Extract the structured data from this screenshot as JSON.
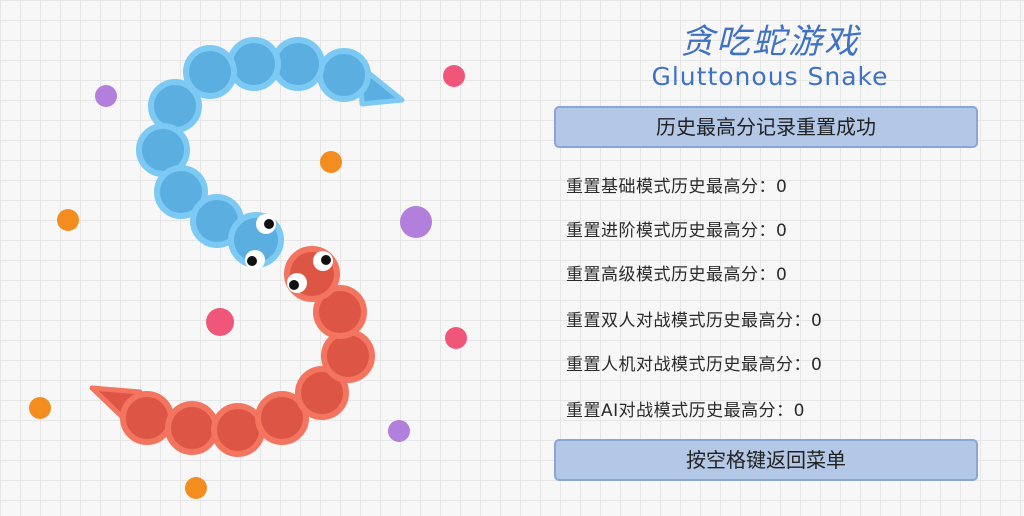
{
  "title": {
    "cn": "贪吃蛇游戏",
    "en": "Gluttonous Snake"
  },
  "status_message": "历史最高分记录重置成功",
  "reset_options": [
    {
      "label": "重置基础模式历史最高分：",
      "score": "0"
    },
    {
      "label": "重置进阶模式历史最高分：",
      "score": "0"
    },
    {
      "label": "重置高级模式历史最高分：",
      "score": "0"
    },
    {
      "label": "重置双人对战模式历史最高分：",
      "score": "0"
    },
    {
      "label": "重置人机对战模式历史最高分：",
      "score": "0"
    },
    {
      "label": "重置AI对战模式历史最高分：",
      "score": "0"
    }
  ],
  "back_button_label": "按空格键返回菜单",
  "colors": {
    "blue_snake_fill": "#5aafe0",
    "blue_snake_ring": "#7cc9f4",
    "red_snake_fill": "#dd5544",
    "red_snake_ring": "#f37560",
    "food_purple": "#b27fdc",
    "food_pink": "#f0567a",
    "food_orange": "#f38d1f",
    "title_blue": "#3f72c4"
  },
  "icons": [
    "snake-eye-icon"
  ]
}
